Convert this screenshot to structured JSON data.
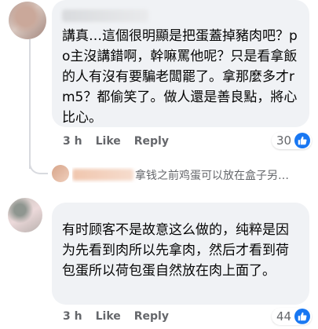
{
  "comments": [
    {
      "text": "講真…這個很明顯是把蛋蓋掉豬肉吧？po主沒講錯啊，幹嘛罵他呢？只是看拿飯的人有沒有要騙老闆罷了。拿那麼多才rm5？都偷笑了。做人還是善良點，將心比心。",
      "time": "3 h",
      "like_label": "Like",
      "reply_label": "Reply",
      "reaction_count": "30",
      "reaction_icon": "like-thumb-icon"
    },
    {
      "text": "有时顾客不是故意这么做的，纯粹是因为先看到肉所以先拿肉，然后才看到荷包蛋所以荷包蛋自然放在肉上面了。",
      "time": "3 h",
      "like_label": "Like",
      "reply_label": "Reply",
      "reaction_count": "44",
      "reaction_icon": "like-thumb-icon"
    }
  ],
  "reply_preview": {
    "text": "拿钱之前鸡蛋可以放在盒子另…"
  },
  "colors": {
    "bubble": "#f0f2f5",
    "meta_text": "#65676b",
    "like_blue": "#1877f2"
  }
}
